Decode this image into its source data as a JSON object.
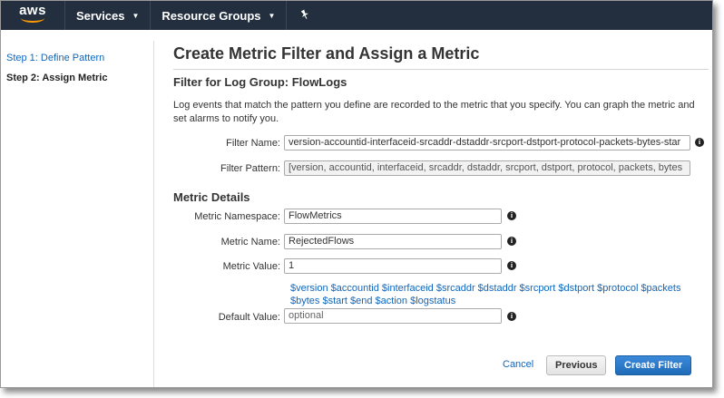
{
  "topbar": {
    "logo": "aws",
    "services_label": "Services",
    "resource_groups_label": "Resource Groups",
    "pin_icon": "pin-icon"
  },
  "steps": {
    "step1": "Step 1: Define Pattern",
    "step2": "Step 2: Assign Metric"
  },
  "page": {
    "title": "Create Metric Filter and Assign a Metric",
    "subtitle": "Filter for Log Group: FlowLogs",
    "description": "Log events that match the pattern you define are recorded to the metric that you specify. You can graph the metric and set alarms to notify you."
  },
  "filter": {
    "name_label": "Filter Name:",
    "name_value": "version-accountid-interfaceid-srcaddr-dstaddr-srcport-dstport-protocol-packets-bytes-star",
    "pattern_label": "Filter Pattern:",
    "pattern_value": "[version, accountid, interfaceid, srcaddr, dstaddr, srcport, dstport, protocol, packets, bytes"
  },
  "metric": {
    "heading": "Metric Details",
    "namespace_label": "Metric Namespace:",
    "namespace_value": "FlowMetrics",
    "name_label": "Metric Name:",
    "name_value": "RejectedFlows",
    "value_label": "Metric Value:",
    "value_value": "1",
    "variables": "$version $accountid $interfaceid $srcaddr $dstaddr $srcport $dstport $protocol $packets $bytes $start $end $action $logstatus",
    "default_label": "Default Value:",
    "default_placeholder": "optional"
  },
  "actions": {
    "cancel": "Cancel",
    "previous": "Previous",
    "create": "Create Filter"
  },
  "colors": {
    "topbar": "#232f3e",
    "link": "#1166bb",
    "primary_button": "#2574c4",
    "aws_orange": "#ff9900"
  }
}
